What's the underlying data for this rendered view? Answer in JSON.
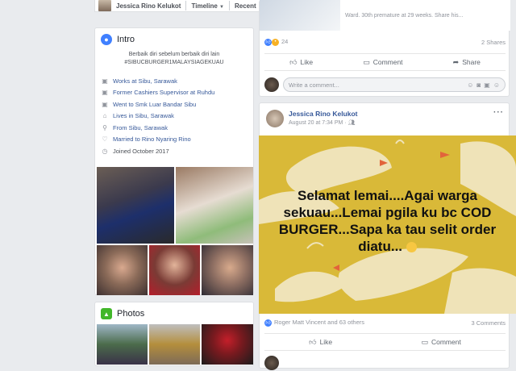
{
  "topbar": {
    "name": "Jessica Rino Kelukot",
    "timeline": "Timeline",
    "recent": "Recent"
  },
  "intro": {
    "title": "Intro",
    "bio": "Berbaik diri sebelum berbaik diri lain #SIBUCBURGER1MALAYSIAGEKUAU",
    "items": [
      {
        "icon": "briefcase-icon",
        "text": "Works at Sibu, Sarawak"
      },
      {
        "icon": "briefcase-icon",
        "text": "Former Cashiers Supervisor at Ruhdu"
      },
      {
        "icon": "briefcase-icon",
        "text": "Went to Smk Luar Bandar Sibu"
      },
      {
        "icon": "home-icon",
        "text": "Lives in Sibu, Sarawak"
      },
      {
        "icon": "location-icon",
        "text": "From Sibu, Sarawak"
      },
      {
        "icon": "heart-icon",
        "text": "Married to Rino Nyaring Rino"
      },
      {
        "icon": "clock-icon",
        "text": "Joined October 2017"
      }
    ]
  },
  "photos": {
    "title": "Photos"
  },
  "post1": {
    "snippet": "Ward. 30th premature at 29 weeks. Share his...",
    "reaction_count": "24",
    "shares": "2 Shares",
    "like": "Like",
    "comment": "Comment",
    "share": "Share",
    "comment_placeholder": "Write a comment..."
  },
  "post2": {
    "author": "Jessica Rino Kelukot",
    "time": "August 20 at 7:34 PM · ",
    "caption": "Selamat lemai....Agai warga sekuau...Lemai pgila ku bc COD BURGER...Sapa ka tau selit order diatu...",
    "reactions_text": "Roger Matt Vincent and 63 others",
    "comments": "3 Comments",
    "like": "Like",
    "comment": "Comment"
  },
  "colors": {
    "link": "#365899",
    "image_bg": "#d9b938",
    "like_blue": "#4080ff"
  }
}
